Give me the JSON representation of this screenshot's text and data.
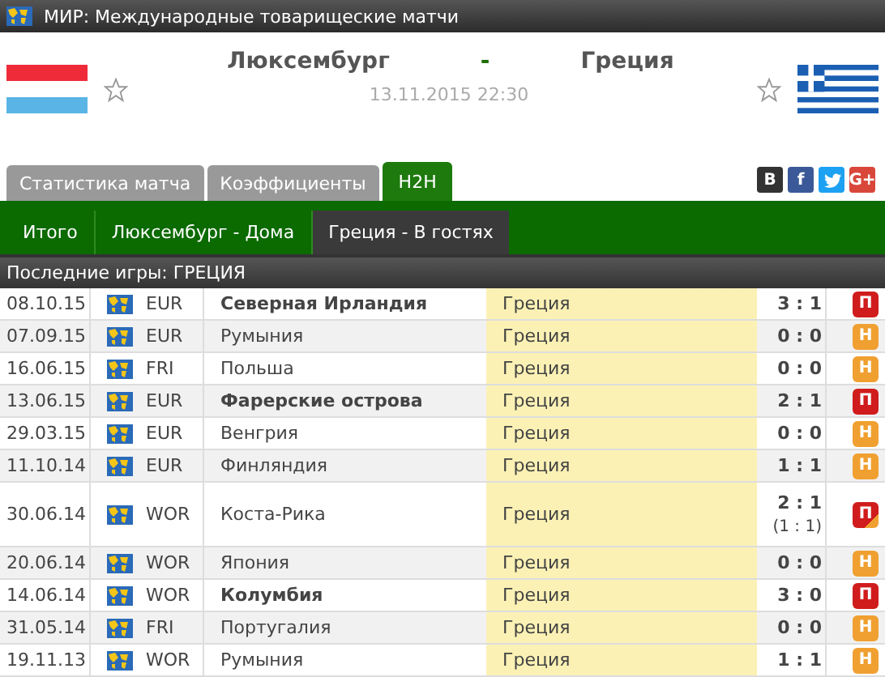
{
  "title": "МИР: Международные товарищеские матчи",
  "match": {
    "home": "Люксембург",
    "separator": "-",
    "away": "Греция",
    "datetime": "13.11.2015 22:30"
  },
  "tabs": [
    {
      "label": "Статистика матча",
      "selected": false
    },
    {
      "label": "Коэффициенты",
      "selected": false
    },
    {
      "label": "H2H",
      "selected": true
    }
  ],
  "share": [
    {
      "kind": "vk",
      "label": "B"
    },
    {
      "kind": "facebook",
      "label": "f"
    },
    {
      "kind": "twitter"
    },
    {
      "kind": "gplus",
      "label": "G+"
    }
  ],
  "subtabs": [
    {
      "label": "Итого",
      "selected": false
    },
    {
      "label": "Люксембург - Дома",
      "selected": false
    },
    {
      "label": "Греция - В гостях",
      "selected": true
    }
  ],
  "section_title": "Последние игры: ГРЕЦИЯ",
  "rows": [
    {
      "date": "08.10.15",
      "competition": "EUR",
      "home": "Северная Ирландия",
      "home_winner": true,
      "away": "Греция",
      "score": "3 : 1",
      "result": {
        "kind": "loss",
        "label": "П"
      }
    },
    {
      "date": "07.09.15",
      "competition": "EUR",
      "home": "Румыния",
      "home_winner": false,
      "away": "Греция",
      "score": "0 : 0",
      "result": {
        "kind": "draw",
        "label": "Н"
      }
    },
    {
      "date": "16.06.15",
      "competition": "FRI",
      "home": "Польша",
      "home_winner": false,
      "away": "Греция",
      "score": "0 : 0",
      "result": {
        "kind": "draw",
        "label": "Н"
      }
    },
    {
      "date": "13.06.15",
      "competition": "EUR",
      "home": "Фарерские острова",
      "home_winner": true,
      "away": "Греция",
      "score": "2 : 1",
      "result": {
        "kind": "loss",
        "label": "П"
      }
    },
    {
      "date": "29.03.15",
      "competition": "EUR",
      "home": "Венгрия",
      "home_winner": false,
      "away": "Греция",
      "score": "0 : 0",
      "result": {
        "kind": "draw",
        "label": "Н"
      }
    },
    {
      "date": "11.10.14",
      "competition": "EUR",
      "home": "Финляндия",
      "home_winner": false,
      "away": "Греция",
      "score": "1 : 1",
      "result": {
        "kind": "draw",
        "label": "Н"
      }
    },
    {
      "date": "30.06.14",
      "competition": "WOR",
      "home": "Коста-Рика",
      "home_winner": false,
      "away": "Греция",
      "score": "2 : 1",
      "score_note": "(1 : 1)",
      "result": {
        "kind": "loss_pen",
        "label": "П"
      }
    },
    {
      "date": "20.06.14",
      "competition": "WOR",
      "home": "Япония",
      "home_winner": false,
      "away": "Греция",
      "score": "0 : 0",
      "result": {
        "kind": "draw",
        "label": "Н"
      }
    },
    {
      "date": "14.06.14",
      "competition": "WOR",
      "home": "Колумбия",
      "home_winner": true,
      "away": "Греция",
      "score": "3 : 0",
      "result": {
        "kind": "loss",
        "label": "П"
      }
    },
    {
      "date": "31.05.14",
      "competition": "FRI",
      "home": "Португалия",
      "home_winner": false,
      "away": "Греция",
      "score": "0 : 0",
      "result": {
        "kind": "draw",
        "label": "Н"
      }
    },
    {
      "date": "19.11.13",
      "competition": "WOR",
      "home": "Румыния",
      "home_winner": false,
      "away": "Греция",
      "score": "1 : 1",
      "result": {
        "kind": "draw",
        "label": "Н"
      }
    }
  ]
}
